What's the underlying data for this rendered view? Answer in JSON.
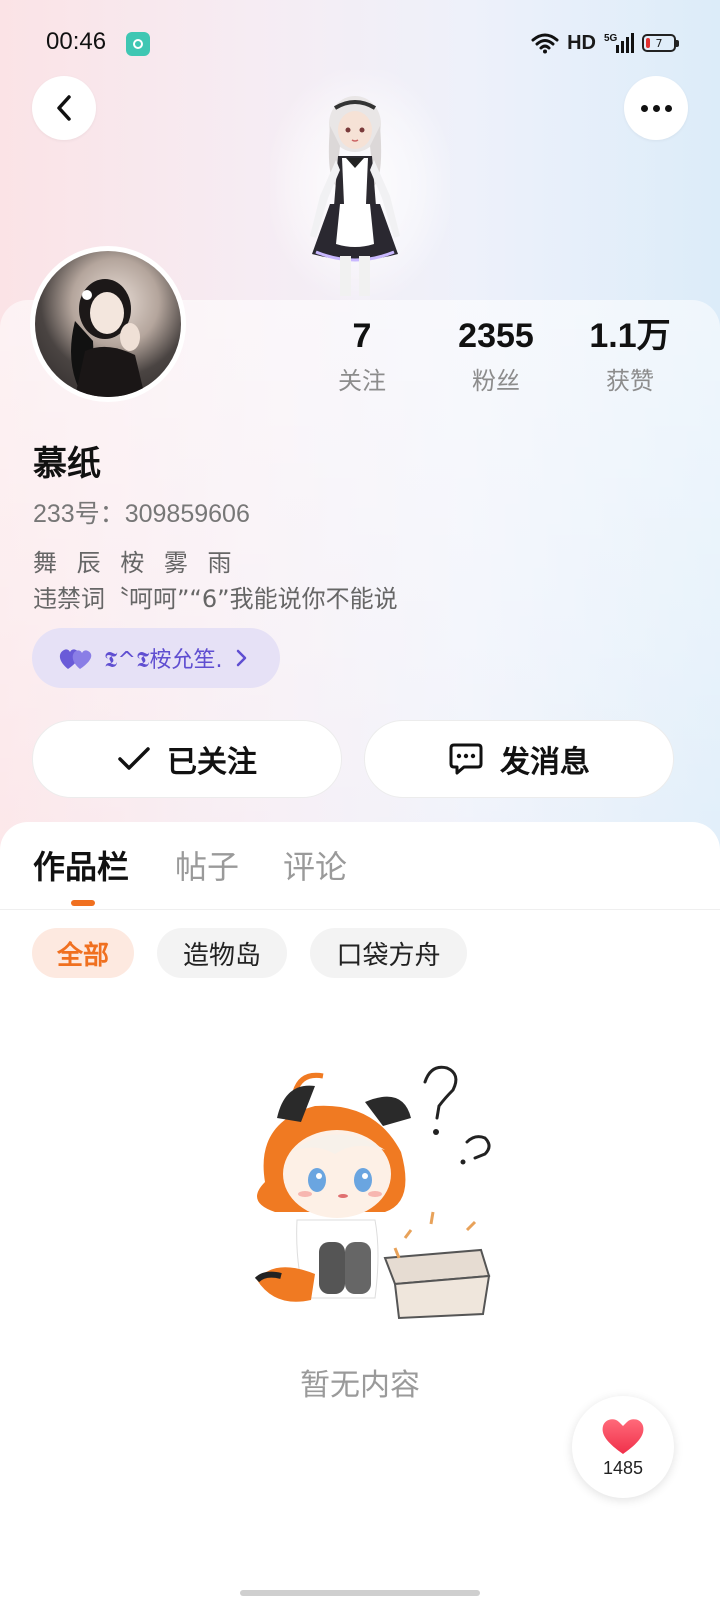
{
  "status_bar": {
    "time": "00:46",
    "network": "HD",
    "signal": "5G",
    "battery": "7"
  },
  "profile": {
    "name": "慕纸",
    "uid": "233号：309859606",
    "bio_line1": "舞 辰 桉 雾 雨",
    "bio_line2": "违禁词〝呵呵”“6”我能说你不能说",
    "group_label": "𝕿^𝕿桉允笙.",
    "stats": [
      {
        "value": "7",
        "label": "关注"
      },
      {
        "value": "2355",
        "label": "粉丝"
      },
      {
        "value": "1.1万",
        "label": "获赞"
      }
    ]
  },
  "actions": {
    "follow_label": "已关注",
    "message_label": "发消息"
  },
  "tabs": [
    {
      "label": "作品栏",
      "active": true
    },
    {
      "label": "帖子",
      "active": false
    },
    {
      "label": "评论",
      "active": false
    }
  ],
  "filters": [
    {
      "label": "全部",
      "active": true
    },
    {
      "label": "造物岛",
      "active": false
    },
    {
      "label": "口袋方舟",
      "active": false
    }
  ],
  "empty_text": "暂无内容",
  "like_count": "1485",
  "colors": {
    "accent": "#f07020",
    "group_purple": "#5f4ed1",
    "like_red": "#f0304a"
  }
}
